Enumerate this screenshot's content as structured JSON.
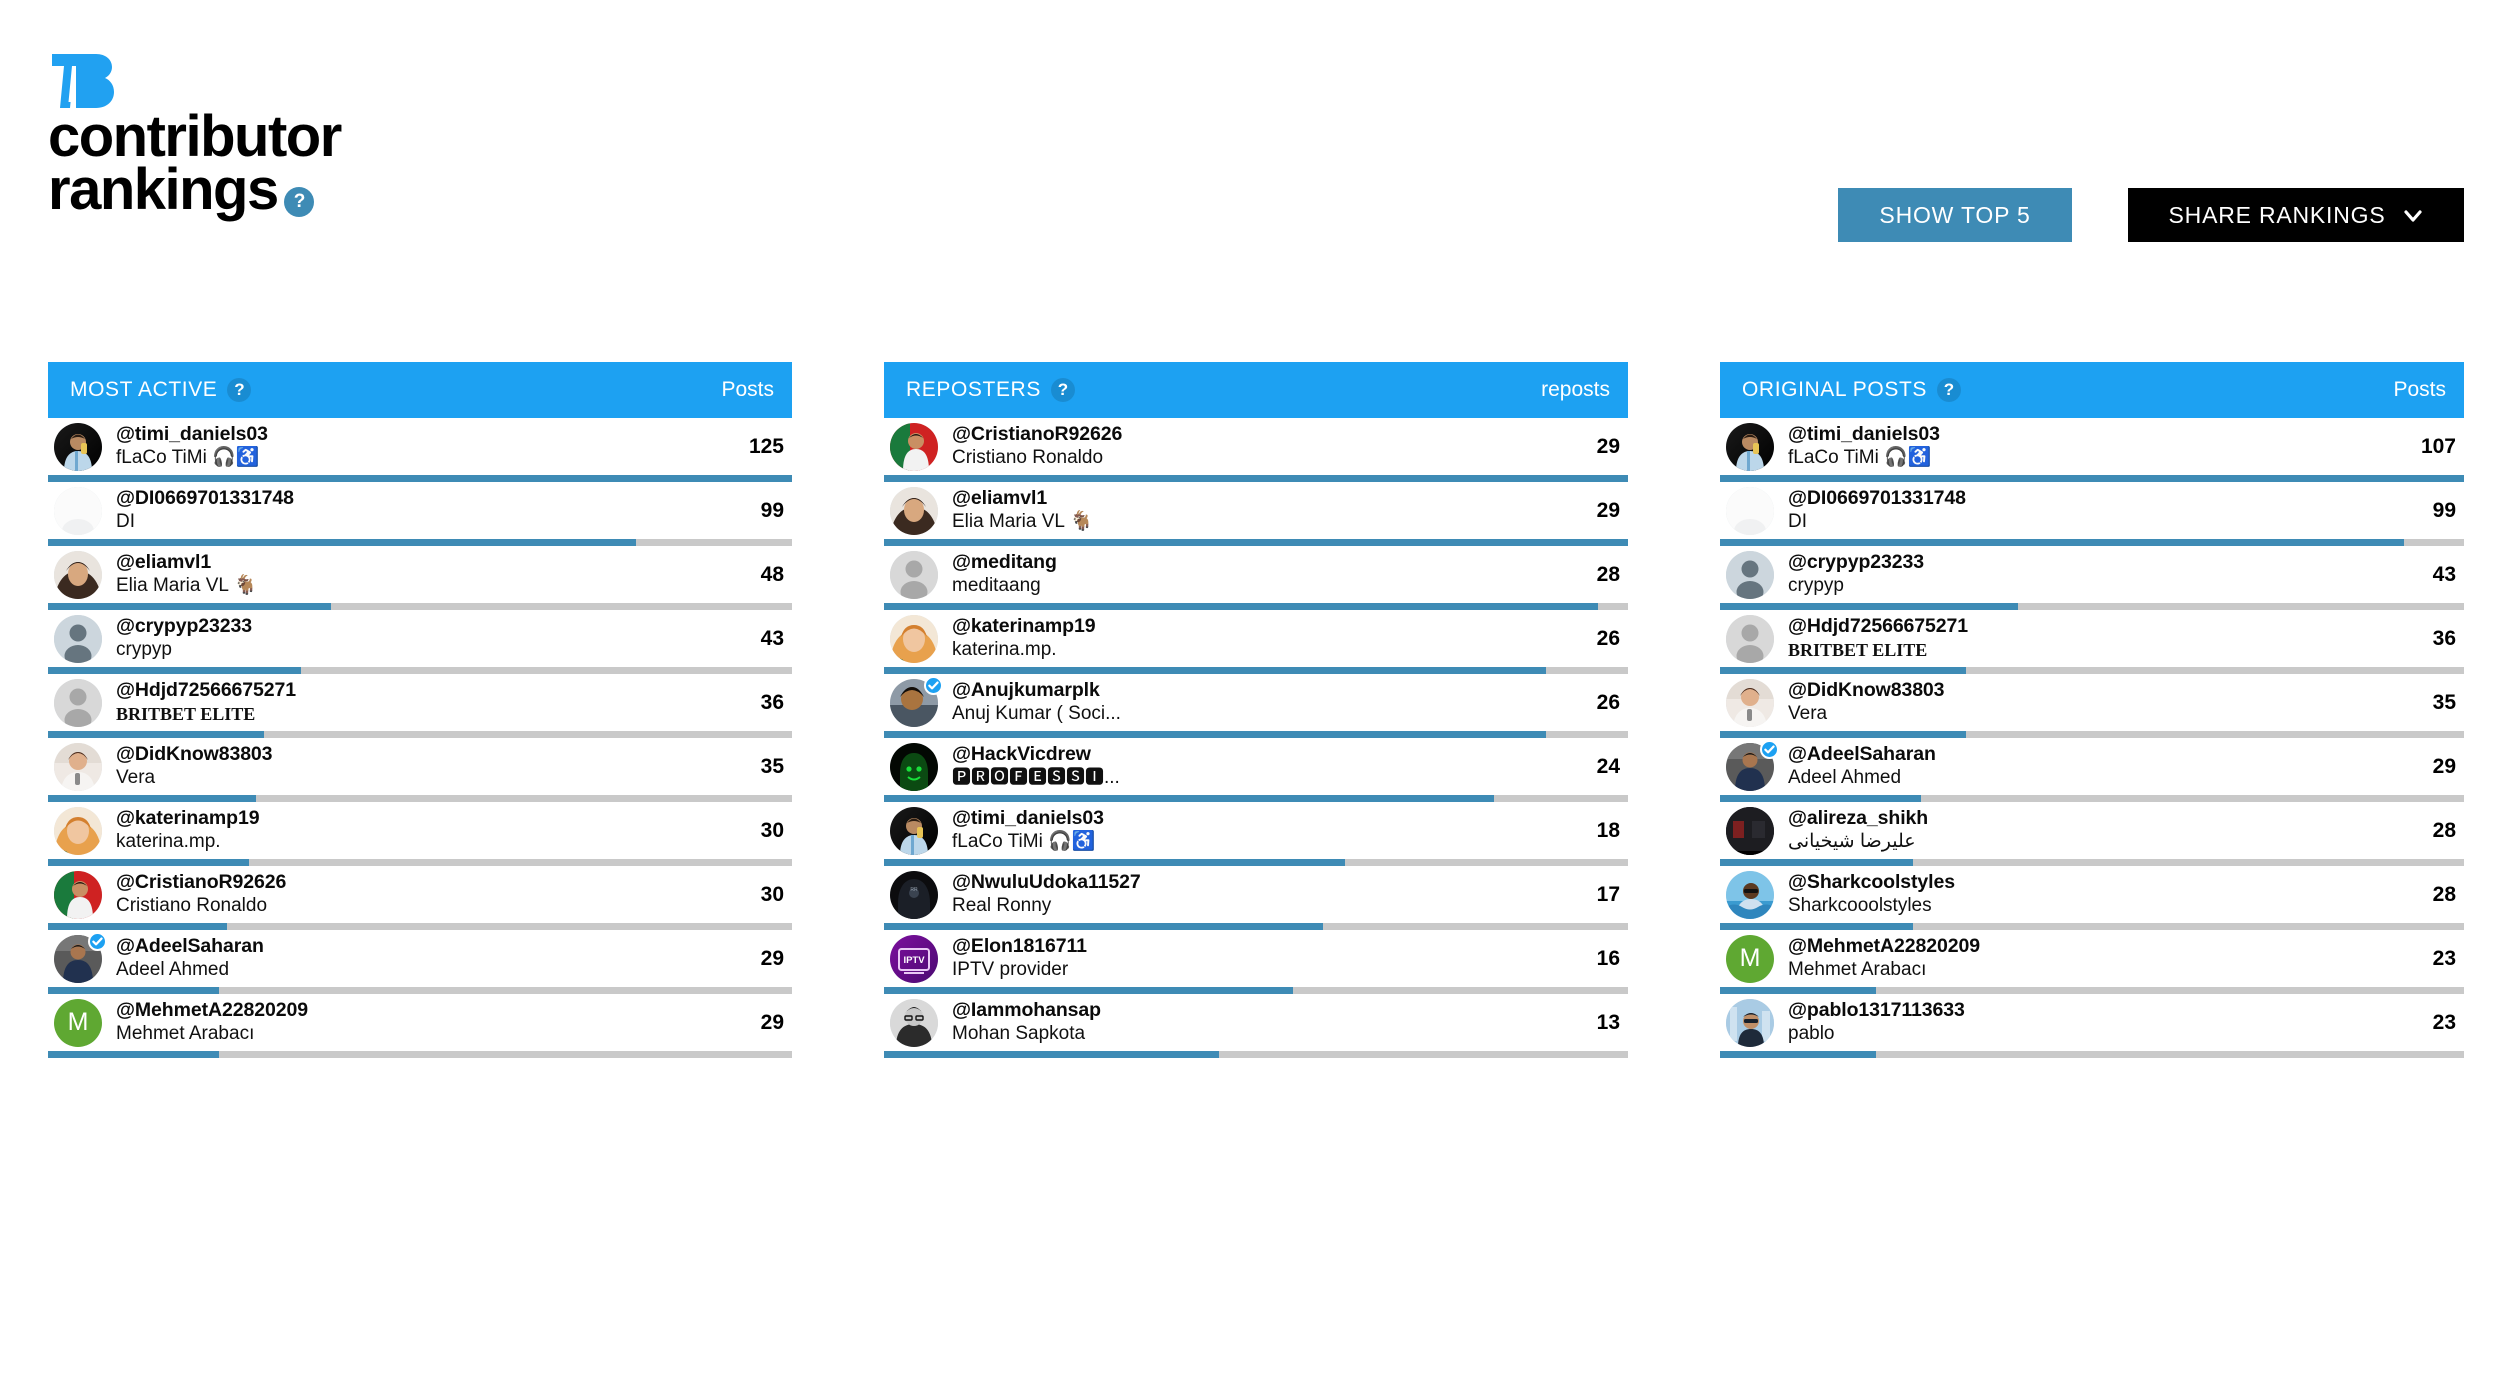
{
  "brand": {
    "logo_name": "logo-7b",
    "title_line1": "contributor",
    "title_line2": "rankings",
    "help_badge": "?"
  },
  "colors": {
    "header_blue": "#1da1f2",
    "accent_blue": "#3e8bb5",
    "bar_track": "#c9c9c9",
    "black": "#000000",
    "verified_blue": "#1da1f2"
  },
  "toolbar": {
    "show_top5_label": "SHOW TOP 5",
    "share_label": "SHARE RANKINGS",
    "share_caret_icon": "chevron-down-icon"
  },
  "columns": [
    {
      "id": "most-active",
      "title": "MOST ACTIVE",
      "help": "?",
      "metric": "Posts",
      "rows": [
        {
          "handle": "@timi_daniels03",
          "name": "fLaCo TiMi 🎧♿",
          "count": "125",
          "pct": 100,
          "verified": false,
          "avatar": "photo-messi"
        },
        {
          "handle": "@DI0669701331748",
          "name": "DI",
          "count": "99",
          "pct": 79,
          "verified": false,
          "avatar": "photo-white"
        },
        {
          "handle": "@eliamvl1",
          "name": "Elia Maria VL 🐐",
          "count": "48",
          "pct": 38,
          "verified": false,
          "avatar": "photo-elia"
        },
        {
          "handle": "@crypyp23233",
          "name": "crypyp",
          "count": "43",
          "pct": 34,
          "verified": false,
          "avatar": "placeholder-blue"
        },
        {
          "handle": "@Hdjd72566675271",
          "name": "BRITBET ELITE",
          "count": "36",
          "pct": 29,
          "verified": false,
          "avatar": "placeholder-gray",
          "serif": true
        },
        {
          "handle": "@DidKnow83803",
          "name": "Vera",
          "count": "35",
          "pct": 28,
          "verified": false,
          "avatar": "photo-vera"
        },
        {
          "handle": "@katerinamp19",
          "name": "katerina.mp.",
          "count": "30",
          "pct": 27,
          "verified": false,
          "avatar": "photo-katerina"
        },
        {
          "handle": "@CristianoR92626",
          "name": "Cristiano Ronaldo",
          "count": "30",
          "pct": 24,
          "verified": false,
          "avatar": "photo-ronaldo"
        },
        {
          "handle": "@AdeelSaharan",
          "name": "Adeel Ahmed",
          "count": "29",
          "pct": 23,
          "verified": true,
          "avatar": "photo-adeel"
        },
        {
          "handle": "@MehmetA22820209",
          "name": "Mehmet Arabacı",
          "count": "29",
          "pct": 23,
          "verified": false,
          "avatar": "initial-green",
          "initial": "M"
        }
      ]
    },
    {
      "id": "reposters",
      "title": "REPOSTERS",
      "help": "?",
      "metric": "reposts",
      "rows": [
        {
          "handle": "@CristianoR92626",
          "name": "Cristiano Ronaldo",
          "count": "29",
          "pct": 100,
          "verified": false,
          "avatar": "photo-ronaldo"
        },
        {
          "handle": "@eliamvl1",
          "name": "Elia Maria VL 🐐",
          "count": "29",
          "pct": 100,
          "verified": false,
          "avatar": "photo-elia"
        },
        {
          "handle": "@meditang",
          "name": "meditaang",
          "count": "28",
          "pct": 96,
          "verified": false,
          "avatar": "placeholder-gray"
        },
        {
          "handle": "@katerinamp19",
          "name": "katerina.mp.",
          "count": "26",
          "pct": 89,
          "verified": false,
          "avatar": "photo-katerina"
        },
        {
          "handle": "@Anujkumarplk",
          "name": "Anuj Kumar ( Soci...",
          "count": "26",
          "pct": 89,
          "verified": true,
          "avatar": "photo-anuj"
        },
        {
          "handle": "@HackVicdrew",
          "name": "🅿🆁🅾🅵🅴🆂🆂🅸...",
          "count": "24",
          "pct": 82,
          "verified": false,
          "avatar": "photo-hacker"
        },
        {
          "handle": "@timi_daniels03",
          "name": "fLaCo TiMi 🎧♿",
          "count": "18",
          "pct": 62,
          "verified": false,
          "avatar": "photo-messi"
        },
        {
          "handle": "@NwuluUdoka11527",
          "name": "Real Ronny",
          "count": "17",
          "pct": 59,
          "verified": false,
          "avatar": "photo-dark"
        },
        {
          "handle": "@Elon1816711",
          "name": "IPTV provider",
          "count": "16",
          "pct": 55,
          "verified": false,
          "avatar": "logo-iptv"
        },
        {
          "handle": "@Iammohansap",
          "name": "Mohan Sapkota",
          "count": "13",
          "pct": 45,
          "verified": false,
          "avatar": "photo-mohan"
        }
      ]
    },
    {
      "id": "original-posts",
      "title": "ORIGINAL POSTS",
      "help": "?",
      "metric": "Posts",
      "rows": [
        {
          "handle": "@timi_daniels03",
          "name": "fLaCo TiMi 🎧♿",
          "count": "107",
          "pct": 100,
          "verified": false,
          "avatar": "photo-messi"
        },
        {
          "handle": "@DI0669701331748",
          "name": "DI",
          "count": "99",
          "pct": 92,
          "verified": false,
          "avatar": "photo-white"
        },
        {
          "handle": "@crypyp23233",
          "name": "crypyp",
          "count": "43",
          "pct": 40,
          "verified": false,
          "avatar": "placeholder-blue"
        },
        {
          "handle": "@Hdjd72566675271",
          "name": "BRITBET ELITE",
          "count": "36",
          "pct": 33,
          "verified": false,
          "avatar": "placeholder-gray",
          "serif": true
        },
        {
          "handle": "@DidKnow83803",
          "name": "Vera",
          "count": "35",
          "pct": 33,
          "verified": false,
          "avatar": "photo-vera"
        },
        {
          "handle": "@AdeelSaharan",
          "name": "Adeel Ahmed",
          "count": "29",
          "pct": 27,
          "verified": true,
          "avatar": "photo-adeel"
        },
        {
          "handle": "@alireza_shikh",
          "name": "علیرضا شیخیانی",
          "count": "28",
          "pct": 26,
          "verified": false,
          "avatar": "photo-alireza"
        },
        {
          "handle": "@Sharkcoolstyles",
          "name": "Sharkcooolstyles",
          "count": "28",
          "pct": 26,
          "verified": false,
          "avatar": "photo-shark"
        },
        {
          "handle": "@MehmetA22820209",
          "name": "Mehmet Arabacı",
          "count": "23",
          "pct": 21,
          "verified": false,
          "avatar": "initial-green",
          "initial": "M"
        },
        {
          "handle": "@pablo1317113633",
          "name": "pablo",
          "count": "23",
          "pct": 21,
          "verified": false,
          "avatar": "photo-pablo"
        }
      ]
    }
  ]
}
